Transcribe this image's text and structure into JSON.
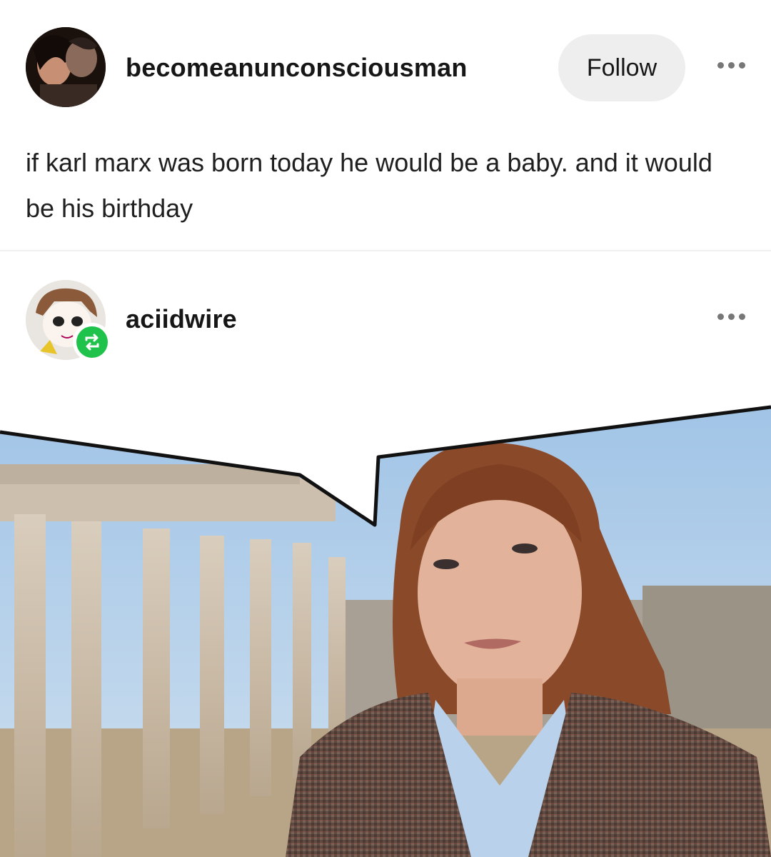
{
  "post": {
    "author": "becomeanunconsciousman",
    "follow_label": "Follow",
    "text": "if karl marx was born today he would be a baby. and it would be his birthday"
  },
  "reblog": {
    "author": "aciidwire"
  },
  "icons": {
    "more": "more-options-icon",
    "reblog": "reblog-icon"
  },
  "colors": {
    "reblog_green": "#1fc24a",
    "follow_bg": "#eeeeef"
  }
}
